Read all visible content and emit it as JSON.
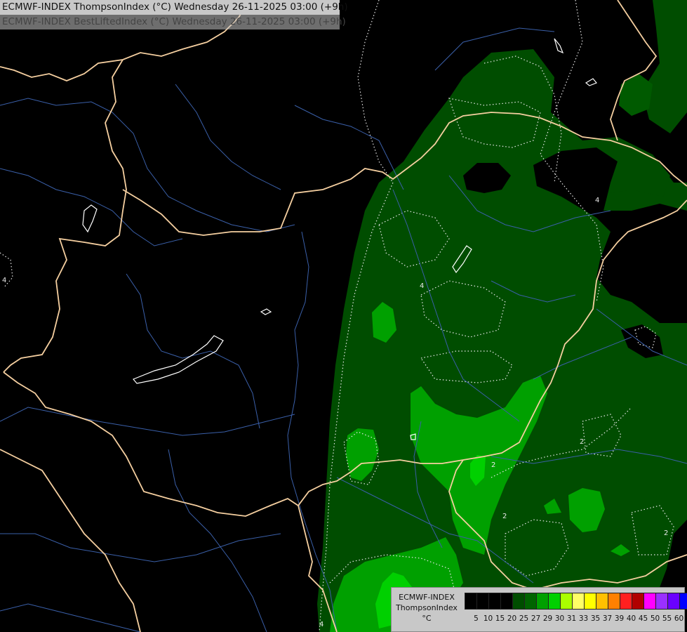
{
  "header": {
    "line1": "ECMWF-INDEX ThompsonIndex (°C) Wednesday 26-11-2025 03:00 (+9h)",
    "line2": "ECMWF-INDEX BestLiftedIndex (°C) Wednesday 26-11-2025 03:00 (+9h)"
  },
  "legend": {
    "title_line1": "ECMWF-INDEX",
    "title_line2": "ThompsonIndex",
    "title_line3": "°C",
    "ticks": [
      "5",
      "10",
      "15",
      "20",
      "25",
      "27",
      "29",
      "30",
      "31",
      "33",
      "35",
      "37",
      "39",
      "40",
      "45",
      "50",
      "55",
      "60"
    ],
    "colors": [
      "#000000",
      "#000000",
      "#000000",
      "#000000",
      "#004d00",
      "#006400",
      "#00a000",
      "#00d000",
      "#aaff00",
      "#ffff66",
      "#ffff00",
      "#ffc000",
      "#ff8000",
      "#ff2020",
      "#b00000",
      "#ff00ff",
      "#9a30ff",
      "#6a00ff",
      "#0000ff"
    ]
  },
  "contour_labels": [
    "4",
    "4",
    "4",
    "2",
    "2",
    "2",
    "2",
    "4"
  ],
  "colors": {
    "border": "#f5cfa0",
    "river": "#3a5fa8",
    "contour": "#e8e8e8",
    "dark_green": "#004d00",
    "mid_green": "#006400",
    "green": "#00a000",
    "bright_green": "#00d000"
  }
}
